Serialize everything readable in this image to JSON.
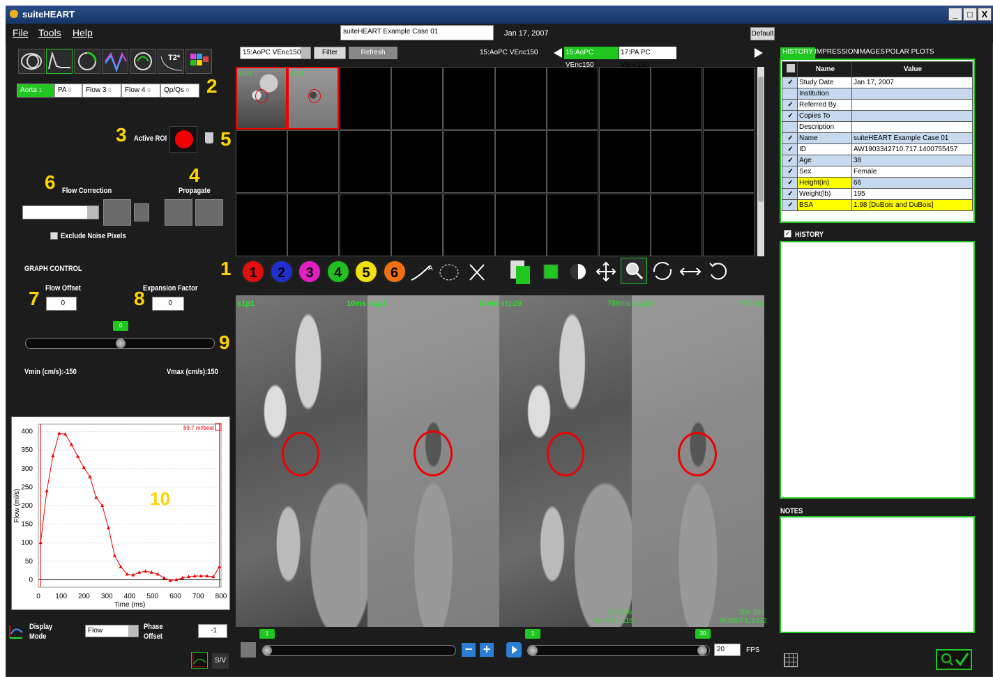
{
  "app": {
    "title": "suiteHEART"
  },
  "menu": {
    "file": "File",
    "tools": "Tools",
    "help": "Help"
  },
  "header": {
    "case_name": "suiteHEART Example Case 01",
    "date": "Jan 17, 2007",
    "default_label": "Default"
  },
  "flow_tabs": [
    {
      "label": "Aorta",
      "count": "1"
    },
    {
      "label": "PA",
      "count": "0"
    },
    {
      "label": "Flow 3",
      "count": "0"
    },
    {
      "label": "Flow 4",
      "count": "0"
    },
    {
      "label": "Qp/Qs",
      "count": "0"
    }
  ],
  "callouts": {
    "n1": "1",
    "n2": "2",
    "n3": "3",
    "n4": "4",
    "n5": "5",
    "n6": "6",
    "n7": "7",
    "n8": "8",
    "n9": "9",
    "n10": "10"
  },
  "roi": {
    "active_label": "Active ROI"
  },
  "flow_correction": {
    "label": "Flow Correction",
    "propagate_label": "Propagate",
    "exclude_noise": "Exclude Noise Pixels"
  },
  "graph_control": {
    "title": "GRAPH CONTROL",
    "flow_offset_label": "Flow Offset",
    "flow_offset_value": "0",
    "expansion_label": "Expansion Factor",
    "expansion_value": "0",
    "slider_thumb": "0",
    "vmin": "Vmin (cm/s):-150",
    "vmax": "Vmax (cm/s):150"
  },
  "series": {
    "selected": "15:AoPC VEnc150",
    "filter": "Filter",
    "refresh": "Refresh",
    "center_title": "15:AoPC VEnc150",
    "tab_a": "15:AoPC VEnc150",
    "tab_b": "17:PA PC VEnc150"
  },
  "thumbs": [
    {
      "label": "s1p1"
    },
    {
      "label": "s1p1"
    }
  ],
  "roi_buttons": [
    "1",
    "2",
    "3",
    "4",
    "5",
    "6"
  ],
  "viewer_labels": {
    "p1_left": "s1p1",
    "p1_time": "10ms",
    "p2_left": "s1p1",
    "p2_time": "10ms",
    "p3_left": "s1p29",
    "p3_time": "786ms",
    "p4_left": "s1p29",
    "p4_time": "786ms",
    "p2_size": "256:256",
    "p2_wl": "W:377 L:116",
    "p4_size": "256:256",
    "p4_wl": "W:3207 L:1372"
  },
  "playback": {
    "left_thumb": "1",
    "right_thumb_start": "1",
    "right_thumb_end": "30",
    "fps_value": "20",
    "fps_label": "FPS"
  },
  "display": {
    "mode_label": "Display Mode",
    "mode_value": "Flow",
    "phase_label": "Phase Offset",
    "phase_value": "-1",
    "sv": "S/V"
  },
  "right_tabs": [
    "HISTORY",
    "IMPRESSION",
    "IMAGES",
    "POLAR PLOTS"
  ],
  "history_table": {
    "headers": [
      "Name",
      "Value"
    ],
    "rows": [
      {
        "name": "Study Date",
        "value": "Jan 17, 2007",
        "checked": true
      },
      {
        "name": "Institution",
        "value": "",
        "checked": false
      },
      {
        "name": "Referred By",
        "value": "",
        "checked": true
      },
      {
        "name": "Copies To",
        "value": "",
        "checked": true
      },
      {
        "name": "Description",
        "value": "",
        "checked": false
      },
      {
        "name": "Name",
        "value": "suiteHEART Example Case 01",
        "checked": true
      },
      {
        "name": "ID",
        "value": "AW1903342710.717.1400755457",
        "checked": true
      },
      {
        "name": "Age",
        "value": "38",
        "checked": true
      },
      {
        "name": "Sex",
        "value": "Female",
        "checked": true
      },
      {
        "name": "Height(in)",
        "value": "66",
        "checked": true
      },
      {
        "name": "Weight(lb)",
        "value": "195",
        "checked": true
      },
      {
        "name": "BSA",
        "value": "1.98 [DuBois and DuBois]",
        "checked": true
      }
    ]
  },
  "history_label": "HISTORY",
  "notes_label": "NOTES",
  "colors": {
    "accent_green": "#21c721",
    "roi_red": "#e00000",
    "callout_yellow": "#ffd400"
  },
  "chart_data": {
    "type": "line",
    "xlabel": "Time (ms)",
    "ylabel": "Flow (ml/s)",
    "annotation": "89.7 ml/beat",
    "xlim": [
      0,
      800
    ],
    "ylim": [
      -20,
      420
    ],
    "xticks": [
      0,
      100,
      200,
      300,
      400,
      500,
      600,
      700,
      800
    ],
    "yticks": [
      0,
      50,
      100,
      150,
      200,
      250,
      300,
      350,
      400
    ],
    "x": [
      10,
      37,
      64,
      91,
      118,
      145,
      172,
      199,
      226,
      253,
      280,
      307,
      334,
      361,
      388,
      415,
      442,
      469,
      496,
      523,
      550,
      577,
      604,
      631,
      658,
      685,
      712,
      739,
      766,
      793
    ],
    "y": [
      100,
      240,
      335,
      395,
      393,
      365,
      333,
      303,
      278,
      222,
      200,
      140,
      65,
      35,
      15,
      13,
      20,
      23,
      20,
      15,
      5,
      -2,
      0,
      5,
      8,
      10,
      10,
      10,
      8,
      35
    ]
  }
}
